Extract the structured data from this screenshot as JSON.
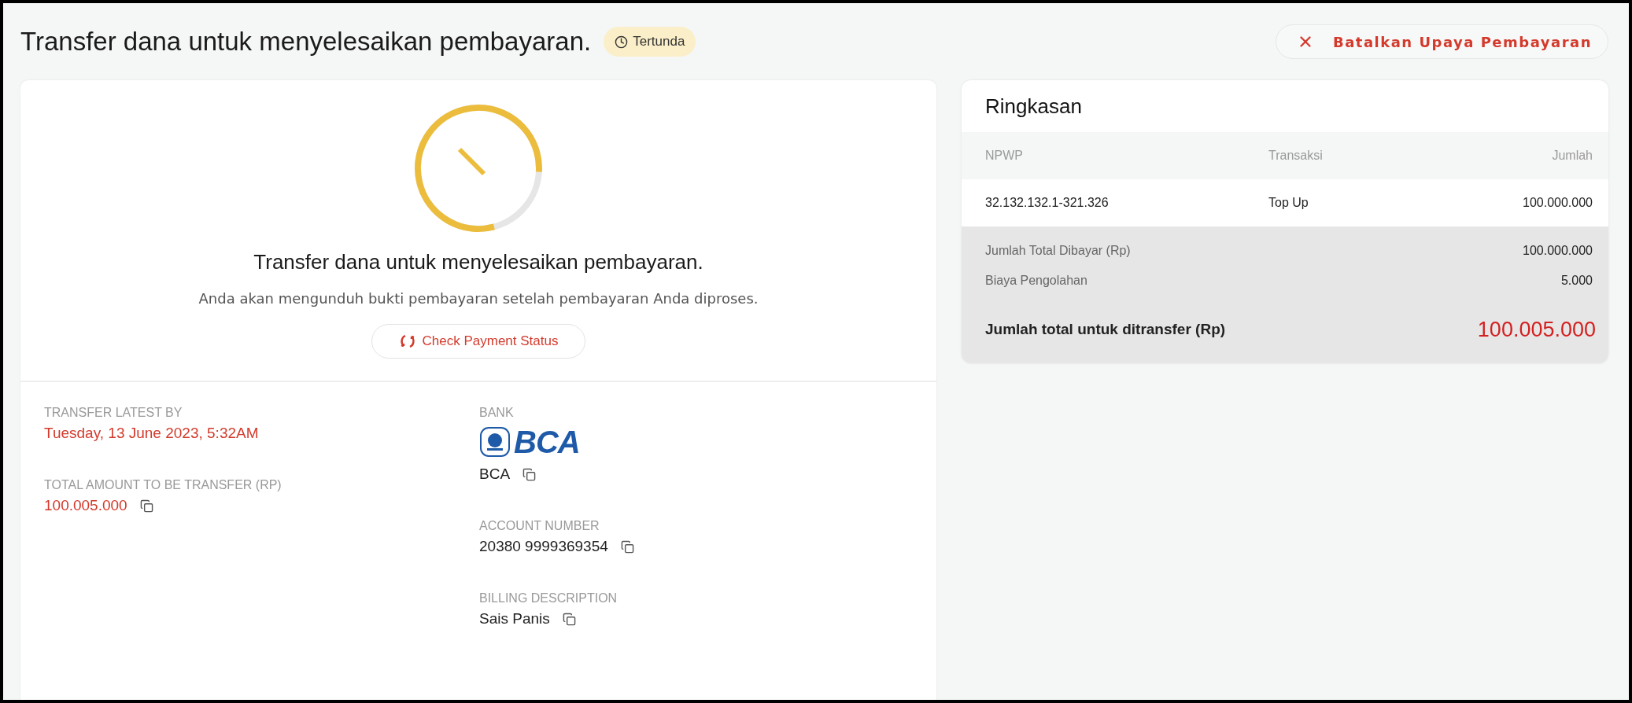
{
  "header": {
    "title": "Transfer dana untuk menyelesaikan pembayaran.",
    "status": {
      "kind": "pending",
      "label": "Tertunda"
    },
    "cancel_button": "Batalkan Upaya Pembayaran"
  },
  "payment": {
    "countdown": {
      "level": 0.8
    },
    "heading": "Transfer dana untuk menyelesaikan pembayaran.",
    "description": "Anda akan mengunduh bukti pembayaran setelah pembayaran Anda diproses.",
    "check_button": "Check Payment Status",
    "details_left": [
      {
        "label": "TRANSFER LATEST BY",
        "value": "Tuesday, 13 June 2023, 5:32AM",
        "highlight": true,
        "copyable": false
      },
      {
        "label": "TOTAL AMOUNT TO BE TRANSFER (RP)",
        "value": "100.005.000",
        "highlight": true,
        "copyable": true
      }
    ],
    "details_right": [
      {
        "label": "BANK",
        "logo_text": "BCA",
        "value": "BCA",
        "highlight": false,
        "copyable": true
      },
      {
        "label": "ACCOUNT NUMBER",
        "value": "20380 9999369354",
        "highlight": false,
        "copyable": true
      },
      {
        "label": "BILLING DESCRIPTION",
        "value": "Sais Panis",
        "highlight": false,
        "copyable": true
      }
    ]
  },
  "summary": {
    "title": "Ringkasan",
    "columns": [
      "NPWP",
      "Transaksi",
      "Jumlah"
    ],
    "rows": [
      [
        "32.132.132.1-321.326",
        "Top Up",
        "100.000.000"
      ]
    ],
    "charges": [
      {
        "label": "Jumlah Total Dibayar (Rp)",
        "value": "100.000.000"
      },
      {
        "label": "Biaya Pengolahan",
        "value": "5.000"
      }
    ],
    "total": {
      "label": "Jumlah total untuk ditransfer (Rp)",
      "value": "100.005.000"
    }
  }
}
